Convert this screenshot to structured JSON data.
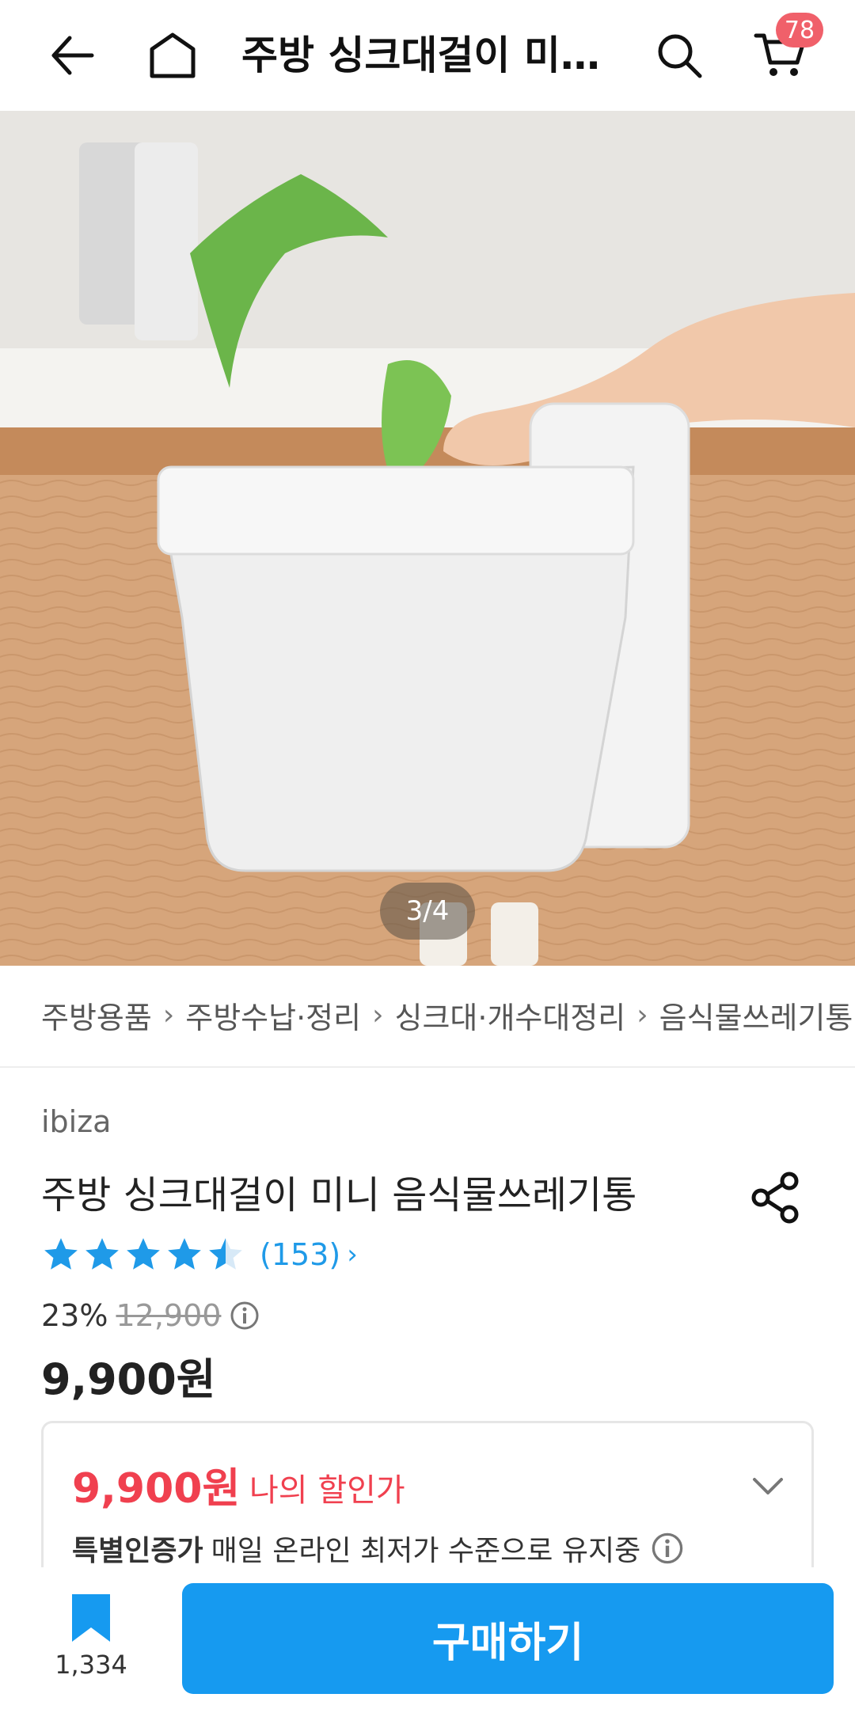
{
  "header": {
    "title": "주방 싱크대걸이 미…",
    "cart_badge": "78"
  },
  "gallery": {
    "counter": "3/4"
  },
  "breadcrumb": {
    "items": [
      "주방용품",
      "주방수납·정리",
      "싱크대·개수대정리",
      "음식물쓰레기통"
    ]
  },
  "product": {
    "brand": "ibiza",
    "name": "주방 싱크대걸이 미니 음식물쓰레기통",
    "rating_stars": 4.5,
    "reviews": "(153)",
    "discount_percent": "23%",
    "original_price": "12,900",
    "price": "9,900원"
  },
  "discount_card": {
    "price": "9,900원",
    "label": "나의 할인가",
    "note_bold": "특별인증가",
    "note_text": "매일 온라인 최저가 수준으로 유지중"
  },
  "bottom": {
    "bookmark_count": "1,334",
    "buy_label": "구매하기"
  },
  "colors": {
    "accent_blue": "#169af0",
    "sale_red": "#f0404f",
    "badge_red": "#f0606a",
    "star_blue": "#1f9ae8"
  }
}
